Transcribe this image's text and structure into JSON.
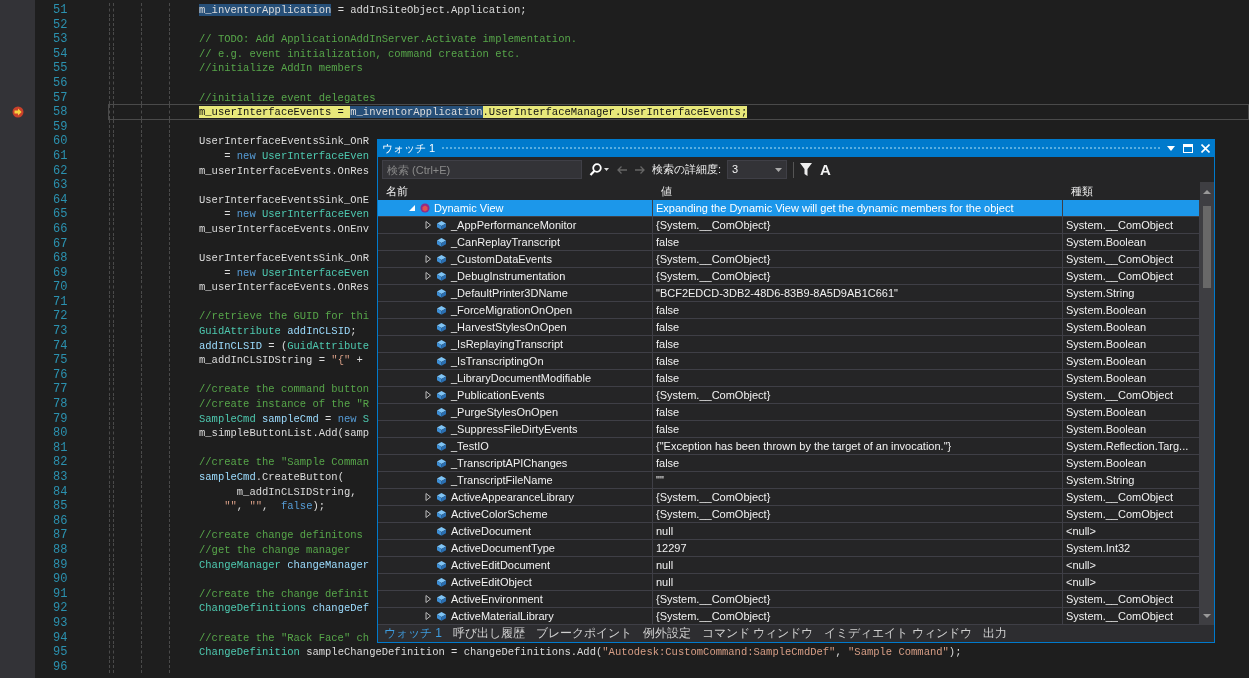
{
  "editor": {
    "lines": [
      {
        "number": "51",
        "current": false,
        "tokens": [
          {
            "t": "m_inventorApplication",
            "kind": "selection"
          },
          {
            "t": " = addInSiteObject.Application;",
            "kind": "plain"
          }
        ]
      },
      {
        "number": "52",
        "current": false
      },
      {
        "number": "53",
        "current": false,
        "tokens": [
          {
            "t": "// TODO: Add ApplicationAddInServer.Activate implementation.",
            "kind": "comment"
          }
        ]
      },
      {
        "number": "54",
        "current": false,
        "tokens": [
          {
            "t": "// e.g. event initialization, command creation etc.",
            "kind": "comment"
          }
        ]
      },
      {
        "number": "55",
        "current": false,
        "tokens": [
          {
            "t": "//initialize AddIn members",
            "kind": "comment"
          }
        ]
      },
      {
        "number": "56",
        "current": false
      },
      {
        "number": "57",
        "current": false,
        "tokens": [
          {
            "t": "//initialize event delegates",
            "kind": "comment"
          }
        ]
      },
      {
        "number": "58",
        "current": true,
        "tokens": [
          {
            "t": "m_userInterfaceEvents = ",
            "kind": "current"
          },
          {
            "t": "m_inventorApplication",
            "kind": "selection"
          },
          {
            "t": ".UserInterfaceManager.UserInterfaceEvents;",
            "kind": "current"
          }
        ]
      },
      {
        "number": "59",
        "current": false
      },
      {
        "number": "60",
        "current": false,
        "tokens": [
          {
            "t": "UserInterfaceEventsSink_OnR",
            "kind": "plain"
          }
        ]
      },
      {
        "number": "61",
        "current": false,
        "tokens": [
          {
            "t": "    = ",
            "kind": "plain"
          },
          {
            "t": "new",
            "kind": "keyword"
          },
          {
            "t": " UserInterfaceEven",
            "kind": "type"
          }
        ]
      },
      {
        "number": "62",
        "current": false,
        "tokens": [
          {
            "t": "m_userInterfaceEvents.OnRes",
            "kind": "plain"
          }
        ]
      },
      {
        "number": "63",
        "current": false
      },
      {
        "number": "64",
        "current": false,
        "tokens": [
          {
            "t": "UserInterfaceEventsSink_OnE",
            "kind": "plain"
          }
        ]
      },
      {
        "number": "65",
        "current": false,
        "tokens": [
          {
            "t": "    = ",
            "kind": "plain"
          },
          {
            "t": "new",
            "kind": "keyword"
          },
          {
            "t": " UserInterfaceEven",
            "kind": "type"
          }
        ]
      },
      {
        "number": "66",
        "current": false,
        "tokens": [
          {
            "t": "m_userInterfaceEvents.OnEnv",
            "kind": "plain"
          }
        ]
      },
      {
        "number": "67",
        "current": false
      },
      {
        "number": "68",
        "current": false,
        "tokens": [
          {
            "t": "UserInterfaceEventsSink_OnR",
            "kind": "plain"
          }
        ]
      },
      {
        "number": "69",
        "current": false,
        "tokens": [
          {
            "t": "    = ",
            "kind": "plain"
          },
          {
            "t": "new",
            "kind": "keyword"
          },
          {
            "t": " UserInterfaceEven",
            "kind": "type"
          }
        ]
      },
      {
        "number": "70",
        "current": false,
        "tokens": [
          {
            "t": "m_userInterfaceEvents.OnRes",
            "kind": "plain"
          }
        ]
      },
      {
        "number": "71",
        "current": false
      },
      {
        "number": "72",
        "current": false,
        "tokens": [
          {
            "t": "//retrieve the GUID for thi",
            "kind": "comment"
          }
        ]
      },
      {
        "number": "73",
        "current": false,
        "tokens": [
          {
            "t": "GuidAttribute",
            "kind": "type"
          },
          {
            "t": " addInCLSID",
            "kind": "variable"
          },
          {
            "t": ";",
            "kind": "plain"
          }
        ]
      },
      {
        "number": "74",
        "current": false,
        "tokens": [
          {
            "t": "addInCLSID",
            "kind": "variable"
          },
          {
            "t": " = (",
            "kind": "plain"
          },
          {
            "t": "GuidAttribute",
            "kind": "type"
          }
        ]
      },
      {
        "number": "75",
        "current": false,
        "tokens": [
          {
            "t": "m_addInCLSIDString = ",
            "kind": "plain"
          },
          {
            "t": "\"{\"",
            "kind": "string"
          },
          {
            "t": " +",
            "kind": "plain"
          }
        ]
      },
      {
        "number": "76",
        "current": false
      },
      {
        "number": "77",
        "current": false,
        "tokens": [
          {
            "t": "//create the command button",
            "kind": "comment"
          }
        ]
      },
      {
        "number": "78",
        "current": false,
        "tokens": [
          {
            "t": "//create instance of the \"R",
            "kind": "comment"
          }
        ]
      },
      {
        "number": "79",
        "current": false,
        "tokens": [
          {
            "t": "SampleCmd",
            "kind": "type"
          },
          {
            "t": " sampleCmd",
            "kind": "variable"
          },
          {
            "t": " = ",
            "kind": "plain"
          },
          {
            "t": "new",
            "kind": "keyword"
          },
          {
            "t": " S",
            "kind": "type"
          }
        ]
      },
      {
        "number": "80",
        "current": false,
        "tokens": [
          {
            "t": "m_simpleButtonList.Add(samp",
            "kind": "plain"
          }
        ]
      },
      {
        "number": "81",
        "current": false
      },
      {
        "number": "82",
        "current": false,
        "tokens": [
          {
            "t": "//create the \"Sample Comman",
            "kind": "comment"
          }
        ]
      },
      {
        "number": "83",
        "current": false,
        "tokens": [
          {
            "t": "sampleCmd",
            "kind": "variable"
          },
          {
            "t": ".CreateButton(",
            "kind": "plain"
          }
        ]
      },
      {
        "number": "84",
        "current": false,
        "tokens": [
          {
            "t": "      m_addInCLSIDString,",
            "kind": "plain"
          }
        ]
      },
      {
        "number": "85",
        "current": false,
        "tokens": [
          {
            "t": "    \"\"",
            "kind": "string"
          },
          {
            "t": ", ",
            "kind": "plain"
          },
          {
            "t": "\"\"",
            "kind": "string"
          },
          {
            "t": ",  ",
            "kind": "plain"
          },
          {
            "t": "false",
            "kind": "keyword"
          },
          {
            "t": ");",
            "kind": "plain"
          }
        ]
      },
      {
        "number": "86",
        "current": false
      },
      {
        "number": "87",
        "current": false,
        "tokens": [
          {
            "t": "//create change definitons",
            "kind": "comment"
          }
        ]
      },
      {
        "number": "88",
        "current": false,
        "tokens": [
          {
            "t": "//get the change manager",
            "kind": "comment"
          }
        ]
      },
      {
        "number": "89",
        "current": false,
        "tokens": [
          {
            "t": "ChangeManager",
            "kind": "type"
          },
          {
            "t": " changeManager",
            "kind": "variable"
          }
        ]
      },
      {
        "number": "90",
        "current": false
      },
      {
        "number": "91",
        "current": false,
        "tokens": [
          {
            "t": "//create the change definit",
            "kind": "comment"
          }
        ]
      },
      {
        "number": "92",
        "current": false,
        "tokens": [
          {
            "t": "ChangeDefinitions",
            "kind": "type"
          },
          {
            "t": " changeDef",
            "kind": "variable"
          }
        ]
      },
      {
        "number": "93",
        "current": false
      },
      {
        "number": "94",
        "current": false,
        "tokens": [
          {
            "t": "//create the \"Rack Face\" ch",
            "kind": "comment"
          }
        ]
      },
      {
        "number": "95",
        "current": false,
        "tokens": [
          {
            "t": "ChangeDefinition",
            "kind": "type"
          },
          {
            "t": " sampleChangeDefinition = changeDefinitions.Add(",
            "kind": "plain"
          },
          {
            "t": "\"Autodesk:CustomCommand:SampleCmdDef\"",
            "kind": "string"
          },
          {
            "t": ", ",
            "kind": "plain"
          },
          {
            "t": "\"Sample Command\"",
            "kind": "string"
          },
          {
            "t": ");",
            "kind": "plain"
          }
        ]
      },
      {
        "number": "96",
        "current": false
      }
    ]
  },
  "watch": {
    "title": "ウォッチ 1",
    "search": {
      "placeholder": "検索 (Ctrl+E)"
    },
    "depth_label": "検索の詳細度:",
    "depth_value": "3",
    "case_button": "A",
    "columns": [
      "名前",
      "値",
      "種類"
    ],
    "rows": [
      {
        "name": "Dynamic View",
        "value": "Expanding the Dynamic View will get the dynamic members for the object",
        "kind": "dynamic",
        "expandable": true,
        "expanded": true,
        "selected": true,
        "children": [
          {
            "name": "_AppPerformanceMonitor",
            "value": "{System.__ComObject}",
            "type": "System.__ComObject",
            "kind": "property",
            "expandable": true,
            "expanded": false,
            "selected": false
          },
          {
            "name": "_CanReplayTranscript",
            "value": "false",
            "type": "System.Boolean",
            "kind": "property",
            "expandable": false,
            "expanded": false,
            "selected": false
          },
          {
            "name": "_CustomDataEvents",
            "value": "{System.__ComObject}",
            "type": "System.__ComObject",
            "kind": "property",
            "expandable": true,
            "expanded": false,
            "selected": false
          },
          {
            "name": "_DebugInstrumentation",
            "value": "{System.__ComObject}",
            "type": "System.__ComObject",
            "kind": "property",
            "expandable": true,
            "expanded": false,
            "selected": false
          },
          {
            "name": "_DefaultPrinter3DName",
            "value": "\"BCF2EDCD-3DB2-48D6-83B9-8A5D9AB1C661\"",
            "type": "System.String",
            "kind": "property",
            "expandable": false,
            "expanded": false,
            "selected": false
          },
          {
            "name": "_ForceMigrationOnOpen",
            "value": "false",
            "type": "System.Boolean",
            "kind": "property",
            "expandable": false,
            "expanded": false,
            "selected": false
          },
          {
            "name": "_HarvestStylesOnOpen",
            "value": "false",
            "type": "System.Boolean",
            "kind": "property",
            "expandable": false,
            "expanded": false,
            "selected": false
          },
          {
            "name": "_IsReplayingTranscript",
            "value": "false",
            "type": "System.Boolean",
            "kind": "property",
            "expandable": false,
            "expanded": false,
            "selected": false
          },
          {
            "name": "_IsTranscriptingOn",
            "value": "false",
            "type": "System.Boolean",
            "kind": "property",
            "expandable": false,
            "expanded": false,
            "selected": false
          },
          {
            "name": "_LibraryDocumentModifiable",
            "value": "false",
            "type": "System.Boolean",
            "kind": "property",
            "expandable": false,
            "expanded": false,
            "selected": false
          },
          {
            "name": "_PublicationEvents",
            "value": "{System.__ComObject}",
            "type": "System.__ComObject",
            "kind": "property",
            "expandable": true,
            "expanded": false,
            "selected": false
          },
          {
            "name": "_PurgeStylesOnOpen",
            "value": "false",
            "type": "System.Boolean",
            "kind": "property",
            "expandable": false,
            "expanded": false,
            "selected": false
          },
          {
            "name": "_SuppressFileDirtyEvents",
            "value": "false",
            "type": "System.Boolean",
            "kind": "property",
            "expandable": false,
            "expanded": false,
            "selected": false
          },
          {
            "name": "_TestIO",
            "value": "{\"Exception has been thrown by the target of an invocation.\"}",
            "type": "System.Reflection.Targ...",
            "kind": "property",
            "expandable": false,
            "expanded": false,
            "selected": false
          },
          {
            "name": "_TranscriptAPIChanges",
            "value": "false",
            "type": "System.Boolean",
            "kind": "property",
            "expandable": false,
            "expanded": false,
            "selected": false
          },
          {
            "name": "_TranscriptFileName",
            "value": "\"\"",
            "type": "System.String",
            "kind": "property",
            "expandable": false,
            "expanded": false,
            "selected": false
          },
          {
            "name": "ActiveAppearanceLibrary",
            "value": "{System.__ComObject}",
            "type": "System.__ComObject",
            "kind": "property",
            "expandable": true,
            "expanded": false,
            "selected": false
          },
          {
            "name": "ActiveColorScheme",
            "value": "{System.__ComObject}",
            "type": "System.__ComObject",
            "kind": "property",
            "expandable": true,
            "expanded": false,
            "selected": false
          },
          {
            "name": "ActiveDocument",
            "value": "null",
            "type": "<null>",
            "kind": "property",
            "expandable": false,
            "expanded": false,
            "selected": false
          },
          {
            "name": "ActiveDocumentType",
            "value": "12297",
            "type": "System.Int32",
            "kind": "property",
            "expandable": false,
            "expanded": false,
            "selected": false
          },
          {
            "name": "ActiveEditDocument",
            "value": "null",
            "type": "<null>",
            "kind": "property",
            "expandable": false,
            "expanded": false,
            "selected": false
          },
          {
            "name": "ActiveEditObject",
            "value": "null",
            "type": "<null>",
            "kind": "property",
            "expandable": false,
            "expanded": false,
            "selected": false
          },
          {
            "name": "ActiveEnvironment",
            "value": "{System.__ComObject}",
            "type": "System.__ComObject",
            "kind": "property",
            "expandable": true,
            "expanded": false,
            "selected": false
          },
          {
            "name": "ActiveMaterialLibrary",
            "value": "{System.__ComObject}",
            "type": "System.__ComObject",
            "kind": "property",
            "expandable": true,
            "expanded": false,
            "selected": false
          }
        ]
      }
    ],
    "tabs": [
      {
        "label": "ウォッチ 1",
        "selected": true
      },
      {
        "label": "呼び出し履歴",
        "selected": false
      },
      {
        "label": "ブレークポイント",
        "selected": false
      },
      {
        "label": "例外設定",
        "selected": false
      },
      {
        "label": "コマンド ウィンドウ",
        "selected": false
      },
      {
        "label": "イミディエイト ウィンドウ",
        "selected": false
      },
      {
        "label": "出力",
        "selected": false
      }
    ]
  }
}
